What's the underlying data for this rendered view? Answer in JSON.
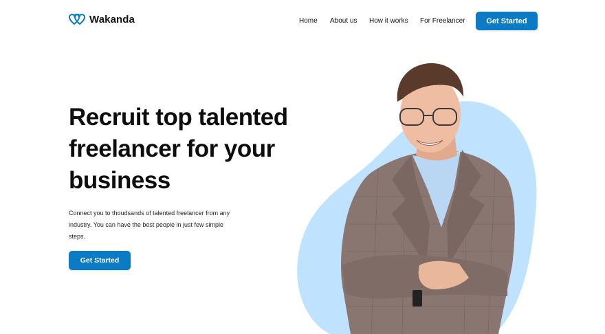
{
  "brand": {
    "name": "Wakanda",
    "logo_icon": "double-heart-logo-icon",
    "accent": "#0a7bc4",
    "blob_color": "#bfe3ff"
  },
  "nav": {
    "items": [
      {
        "label": "Home"
      },
      {
        "label": "About us"
      },
      {
        "label": "How it works"
      },
      {
        "label": "For Freelancer"
      }
    ],
    "cta_label": "Get Started"
  },
  "hero": {
    "headline": "Recruit top talented freelancer for your business",
    "subtext": "Connect you to thoudsands of talented freelancer from any industry. You can have the best people in just few simple steps.",
    "cta_label": "Get Started",
    "image": "smiling-man-in-plaid-blazer-arms-crossed"
  }
}
